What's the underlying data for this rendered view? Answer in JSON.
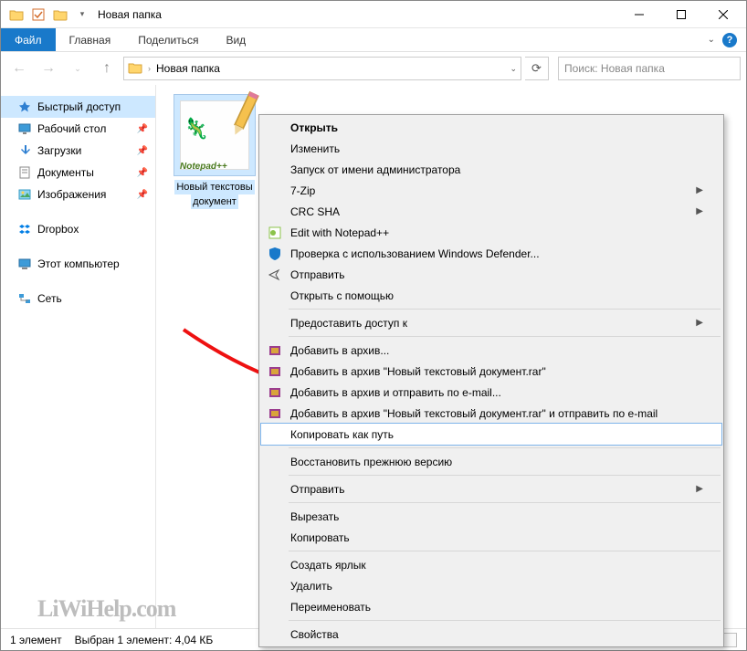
{
  "window": {
    "title": "Новая папка"
  },
  "ribbon": {
    "file": "Файл",
    "home": "Главная",
    "share": "Поделиться",
    "view": "Вид"
  },
  "address": {
    "location": "Новая папка",
    "search_placeholder": "Поиск: Новая папка"
  },
  "sidebar": {
    "quick_access": "Быстрый доступ",
    "desktop": "Рабочий стол",
    "downloads": "Загрузки",
    "documents": "Документы",
    "pictures": "Изображения",
    "dropbox": "Dropbox",
    "this_pc": "Этот компьютер",
    "network": "Сеть"
  },
  "file": {
    "name_line1": "Новый текстовы",
    "name_line2": "документ",
    "badge": "Notepad++"
  },
  "context_menu": {
    "open": "Открыть",
    "edit": "Изменить",
    "run_as_admin": "Запуск от имени администратора",
    "sevenzip": "7-Zip",
    "crc_sha": "CRC SHA",
    "edit_npp": "Edit with Notepad++",
    "defender": "Проверка с использованием Windows Defender...",
    "send": "Отправить",
    "open_with": "Открыть с помощью",
    "give_access": "Предоставить доступ к",
    "add_archive": "Добавить в архив...",
    "add_archive_rar": "Добавить в архив \"Новый текстовый документ.rar\"",
    "add_email": "Добавить в архив и отправить по e-mail...",
    "add_rar_email": "Добавить в архив \"Новый текстовый документ.rar\" и отправить по e-mail",
    "copy_path": "Копировать как путь",
    "restore": "Восстановить прежнюю версию",
    "send_to": "Отправить",
    "cut": "Вырезать",
    "copy": "Копировать",
    "shortcut": "Создать ярлык",
    "delete": "Удалить",
    "rename": "Переименовать",
    "properties": "Свойства"
  },
  "status": {
    "count": "1 элемент",
    "selected": "Выбран 1 элемент: 4,04 КБ"
  },
  "watermark": "LiWiHelp.com"
}
